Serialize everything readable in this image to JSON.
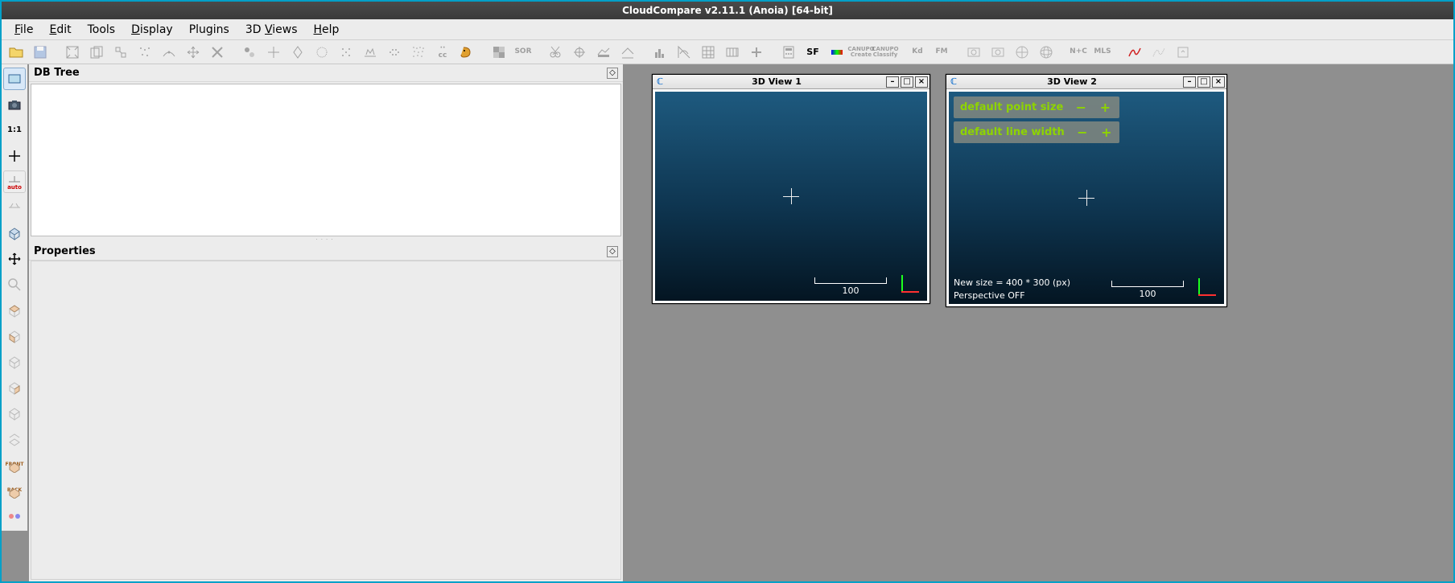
{
  "title": "CloudCompare v2.11.1 (Anoia) [64-bit]",
  "menu": {
    "file": "File",
    "edit": "Edit",
    "tools": "Tools",
    "display": "Display",
    "plugins": "Plugins",
    "views": "3D Views",
    "help": "Help"
  },
  "panels": {
    "dbtree": "DB Tree",
    "properties": "Properties"
  },
  "toolbar_main": {
    "open": "Open",
    "save": "Save",
    "sor_label": "SOR",
    "sf_label": "SF",
    "kd_label": "Kd",
    "fm_label": "FM",
    "nc_label": "N+C",
    "mls_label": "MLS"
  },
  "left_tools": {
    "oneone": "1:1",
    "auto": "auto",
    "front": "FRONT",
    "back": "BACK"
  },
  "view1": {
    "title": "3D View 1",
    "scale": "100"
  },
  "view2": {
    "title": "3D View 2",
    "hud_pointsize": "default point size",
    "hud_linewidth": "default line width",
    "newsize": "New size = 400 * 300 (px)",
    "perspective": "Perspective OFF",
    "scale": "100"
  }
}
